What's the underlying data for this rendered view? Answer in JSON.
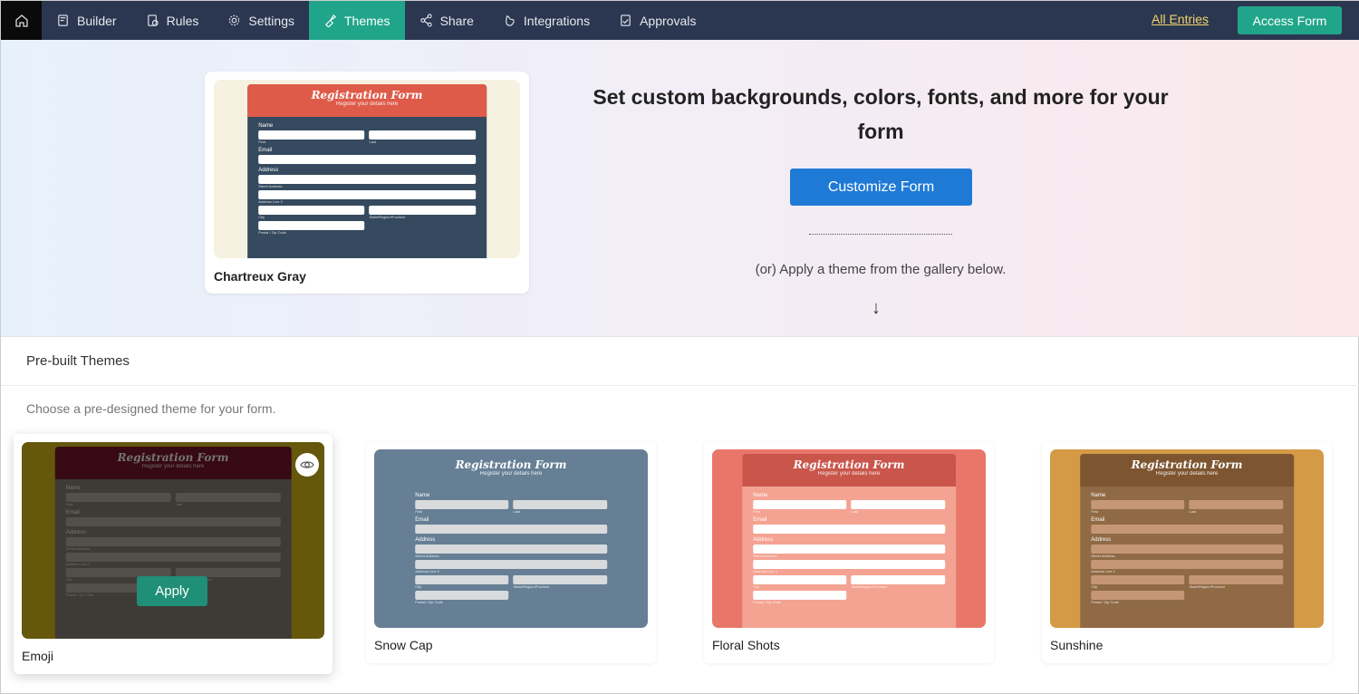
{
  "nav": {
    "items": [
      {
        "label": "Builder",
        "icon": "builder-icon"
      },
      {
        "label": "Rules",
        "icon": "rules-icon"
      },
      {
        "label": "Settings",
        "icon": "gear-icon"
      },
      {
        "label": "Themes",
        "icon": "brush-icon",
        "active": true
      },
      {
        "label": "Share",
        "icon": "share-icon"
      },
      {
        "label": "Integrations",
        "icon": "integrations-icon"
      },
      {
        "label": "Approvals",
        "icon": "approvals-icon"
      }
    ],
    "all_entries": "All Entries",
    "access_form": "Access Form"
  },
  "hero": {
    "current_theme": "Chartreux Gray",
    "heading": "Set custom backgrounds, colors, fonts, and more for your form",
    "customize": "Customize Form",
    "or_text": "(or) Apply a theme from the gallery below.",
    "arrow": "↓"
  },
  "preview": {
    "title": "Registration Form",
    "subtitle": "Register your details here",
    "name": "Name",
    "first": "First",
    "last": "Last",
    "email": "Email",
    "address": "Address",
    "street": "Street Address",
    "line2": "Address Line 2",
    "city": "City",
    "state": "State/Region/Province",
    "zip": "Postal / Zip Code"
  },
  "section": {
    "title": "Pre-built Themes",
    "subtitle": "Choose a pre-designed theme for your form."
  },
  "themes": [
    {
      "name": "Emoji",
      "apply": "Apply",
      "bg": "#e0c21a",
      "head": "#7a1530",
      "body": "#8a8478",
      "input": "#b9b1a5"
    },
    {
      "name": "Snow Cap",
      "bg": "#667f95",
      "head": "#667f95",
      "body": "#667f95",
      "input": "#d8dadc"
    },
    {
      "name": "Floral Shots",
      "bg": "#e8776a",
      "head": "#c9554b",
      "body": "#f4a393",
      "input": "#ffffff"
    },
    {
      "name": "Sunshine",
      "bg": "#d49a46",
      "head": "#7d5530",
      "body": "#8f6a45",
      "input": "#c69776"
    }
  ],
  "current": {
    "bg": "#f6f1e0",
    "head": "#df5b49",
    "body": "#354a5f",
    "input": "#ffffff"
  },
  "colors": {
    "nav": "#2b3750",
    "accent": "#21a58a",
    "primary": "#1f7ad6"
  }
}
